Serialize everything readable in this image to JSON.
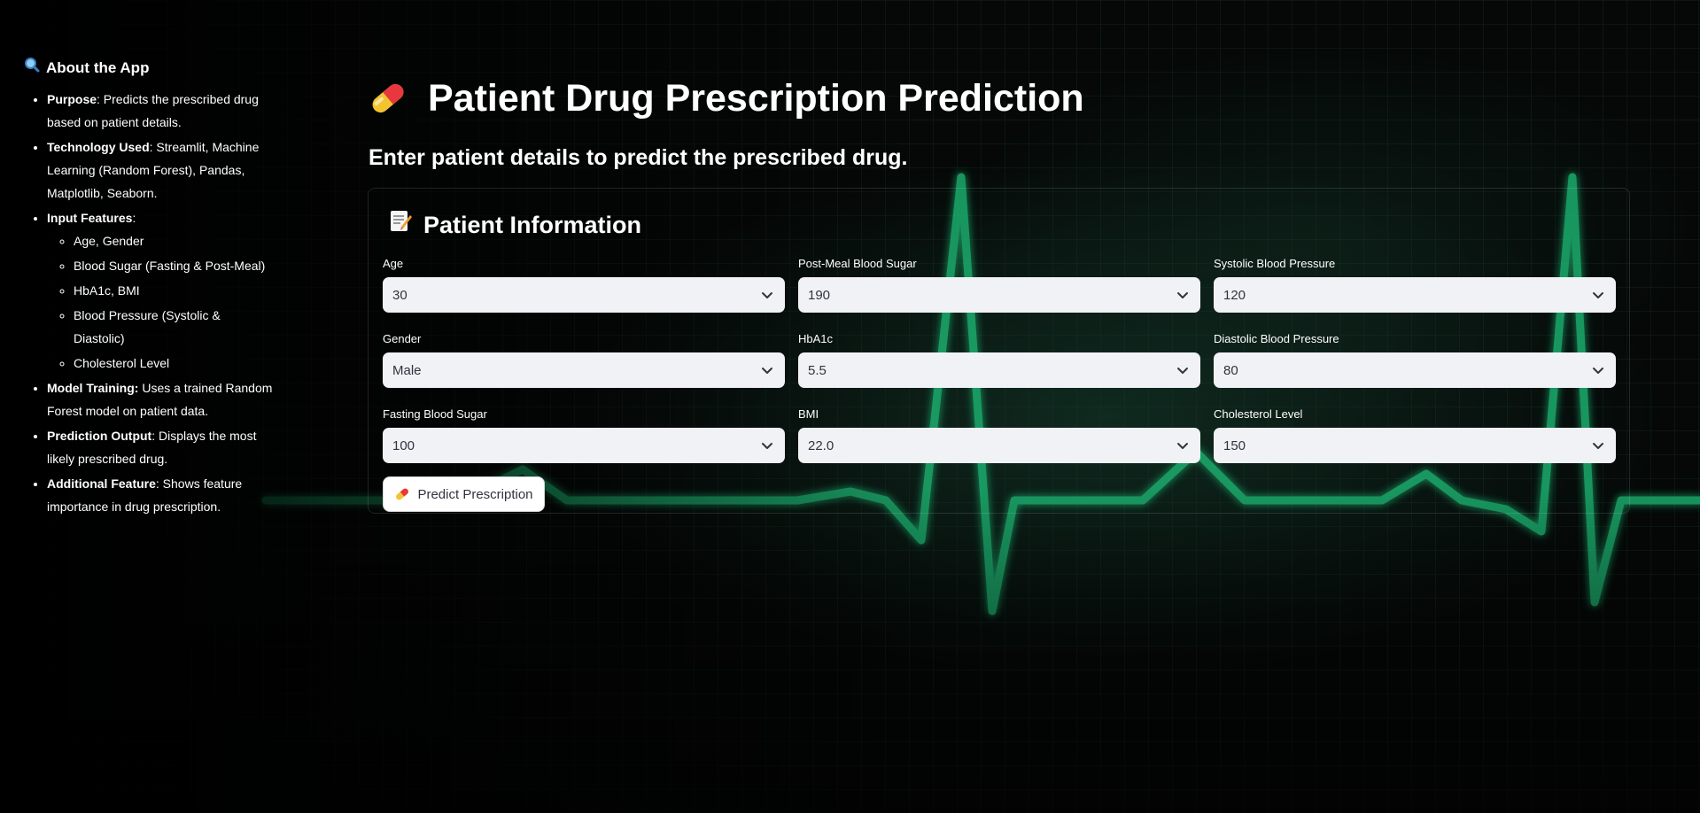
{
  "sidebar": {
    "title": "About the App",
    "icon": "magnifier-icon",
    "items": [
      {
        "label": "Purpose",
        "text": ": Predicts the prescribed drug based on patient details."
      },
      {
        "label": "Technology Used",
        "text": ": Streamlit, Machine Learning (Random Forest), Pandas, Matplotlib, Seaborn."
      },
      {
        "label": "Input Features",
        "text": ":"
      },
      {
        "label": "Model Training:",
        "text": " Uses a trained Random Forest model on patient data."
      },
      {
        "label": "Prediction Output",
        "text": ": Displays the most likely prescribed drug."
      },
      {
        "label": "Additional Feature",
        "text": ": Shows feature importance in drug prescription."
      }
    ],
    "features": [
      "Age, Gender",
      "Blood Sugar (Fasting & Post-Meal)",
      "HbA1c, BMI",
      "Blood Pressure (Systolic & Diastolic)",
      "Cholesterol Level"
    ]
  },
  "main": {
    "title": "Patient Drug Prescription Prediction",
    "title_icon": "pill-icon",
    "subheading": "Enter patient details to predict the prescribed drug.",
    "form": {
      "heading": "Patient Information",
      "heading_icon": "memo-icon",
      "fields": {
        "age": {
          "label": "Age",
          "value": "30"
        },
        "gender": {
          "label": "Gender",
          "value": "Male"
        },
        "fasting": {
          "label": "Fasting Blood Sugar",
          "value": "100"
        },
        "postmeal": {
          "label": "Post-Meal Blood Sugar",
          "value": "190"
        },
        "hba1c": {
          "label": "HbA1c",
          "value": "5.5"
        },
        "bmi": {
          "label": "BMI",
          "value": "22.0"
        },
        "systolic": {
          "label": "Systolic Blood Pressure",
          "value": "120"
        },
        "diastolic": {
          "label": "Diastolic Blood Pressure",
          "value": "80"
        },
        "cholesterol": {
          "label": "Cholesterol Level",
          "value": "150"
        }
      },
      "button_label": "Predict Prescription",
      "button_icon": "pill-icon"
    }
  },
  "colors": {
    "background": "#050807",
    "ecg_line": "#1fae6e",
    "input_bg": "#f0f2f6",
    "input_text": "#31333f"
  }
}
